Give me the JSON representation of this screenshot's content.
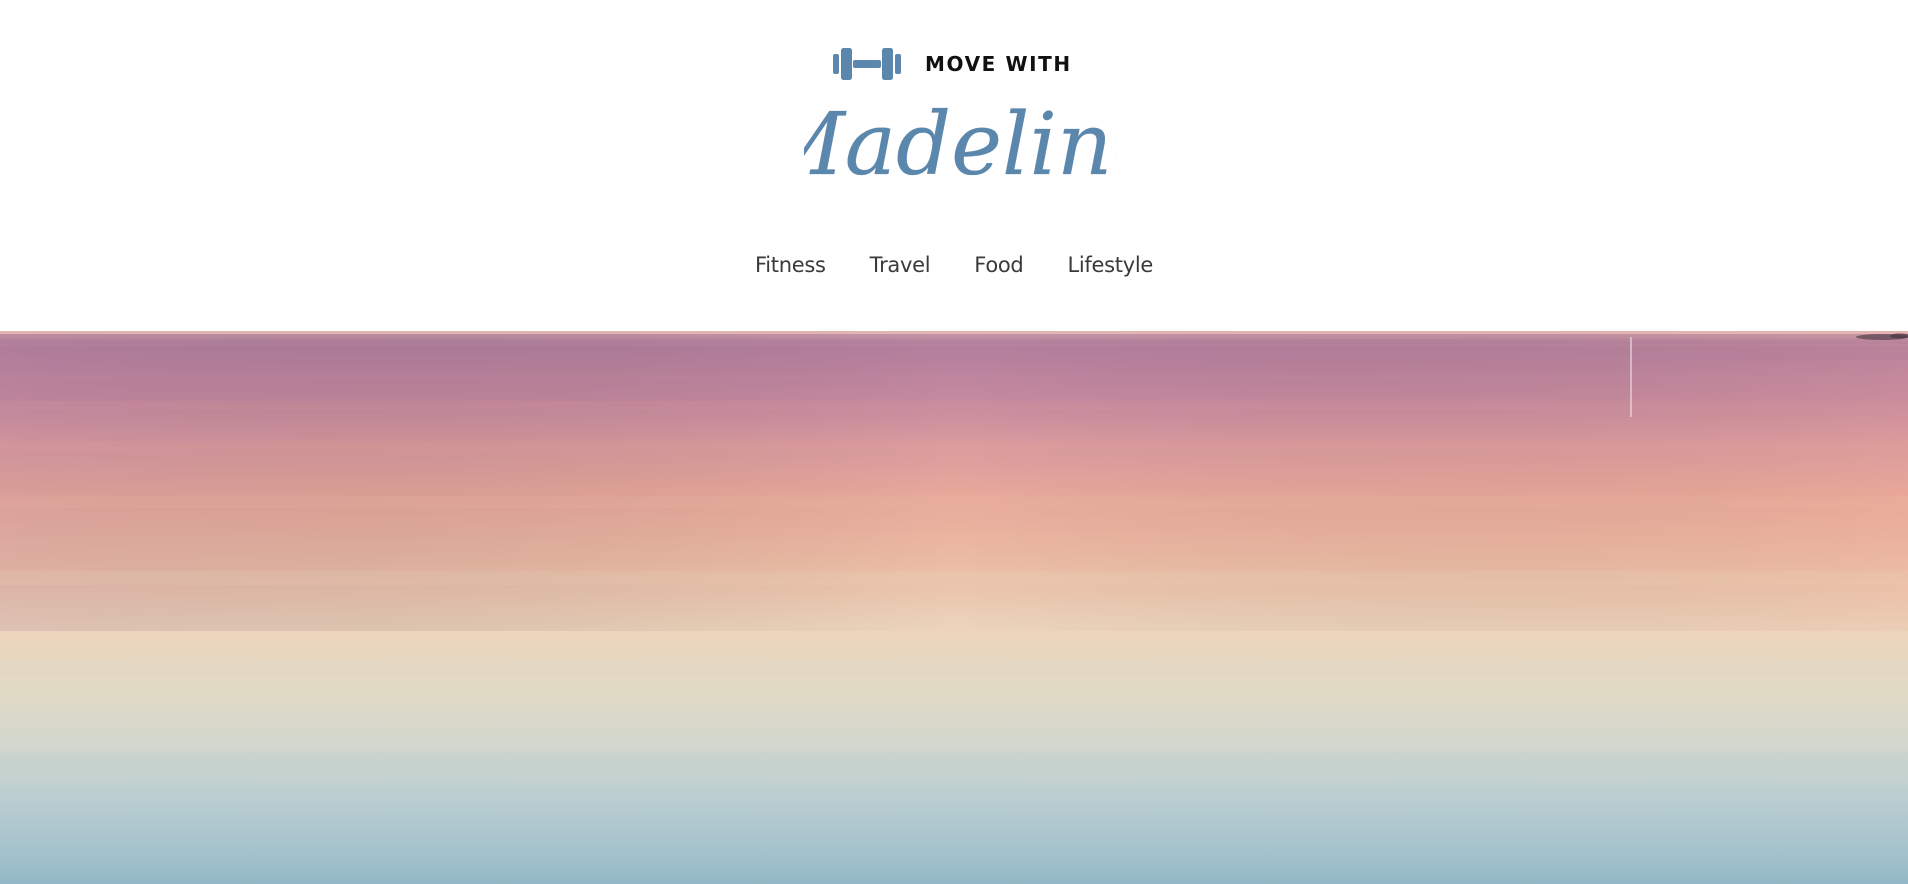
{
  "brand": {
    "icon": "dumbbell-icon",
    "tagline": "MOVE WITH",
    "name": "Madeline",
    "accent_color": "#5b87ad"
  },
  "nav": {
    "items": [
      {
        "label": "Fitness"
      },
      {
        "label": "Travel"
      },
      {
        "label": "Food"
      },
      {
        "label": "Lifestyle"
      }
    ]
  },
  "hero": {
    "image": "pastel-sunset-sea-image",
    "colors": [
      "#b37f9c",
      "#e8a59a",
      "#eed8bf",
      "#d4d9d2",
      "#9dc0cb"
    ]
  }
}
